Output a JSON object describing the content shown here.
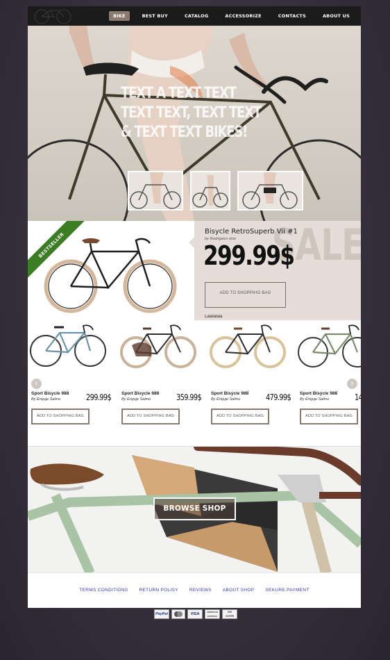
{
  "nav": {
    "items": [
      "BIKE",
      "BEST BUY",
      "CATALOG",
      "ACCESSORIZE",
      "CONTACTS",
      "ABOUT US"
    ],
    "active_index": 0
  },
  "hero": {
    "lines": [
      "TEXT A TEXT TEXT",
      "TEXT TEXT, TEXT TEXT",
      "& TEXT TEXT BIKES!"
    ]
  },
  "featured": {
    "badge": "BESTSELLER",
    "watermark": "SALE",
    "name": "Bisycle RetroSuperb Vii #1",
    "by": "by Rodrigwes else",
    "price": "299.99$",
    "button_label": "ADD TO SHOPPIHG BAG",
    "note": "Lalalalala"
  },
  "products": [
    {
      "name": "Sport Bisycle 988",
      "by": "By Eriquje Salmo",
      "price": "299.99$",
      "button_label": "ADD TO SHOPPIHG BAG"
    },
    {
      "name": "Sport Bisycle 988",
      "by": "By Eriquje Salmo",
      "price": "359.99$",
      "button_label": "ADD TO SHOPPIHG BAG"
    },
    {
      "name": "Sport Bisycle 988",
      "by": "By Eriquje Salmo",
      "price": "479.99$",
      "button_label": "ADD TO SHOPPIHG BAG"
    },
    {
      "name": "Sport Bisycle 988",
      "by": "By Eriquje Salmo",
      "price": "14",
      "button_label": "ADD TO SHOPPIHG BAG"
    }
  ],
  "promo": {
    "button_label": "BROWSE SHOP"
  },
  "footer": {
    "links": [
      "TERMS CONDITIONS",
      "RETURN POLISY",
      "REVIEWS",
      "ABOUT SHOP",
      "SEKURE PAYMENT"
    ]
  },
  "payments": [
    "PayPal",
    "Mastercard",
    "VISA",
    "American Express",
    "Discover"
  ],
  "icons": {
    "prev": "chevron-left-icon",
    "next": "chevron-right-icon"
  },
  "colors": {
    "accent": "#8a7a70",
    "ribbon": "#3a7d22",
    "sale_panel": "#e6ddd8",
    "footer_link": "#3a3aa6"
  }
}
